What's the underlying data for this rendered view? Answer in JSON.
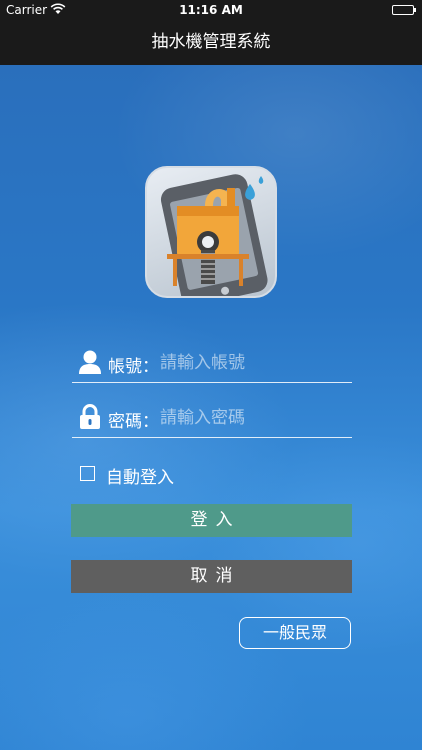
{
  "status_bar": {
    "carrier": "Carrier",
    "time": "11:16 AM"
  },
  "nav": {
    "title": "抽水機管理系統"
  },
  "login": {
    "account_label": "帳號：",
    "account_placeholder": "請輸入帳號",
    "password_label": "密碼：",
    "password_placeholder": "請輸入密碼",
    "auto_login_label": "自動登入",
    "auto_login_checked": false,
    "login_button": "登入",
    "cancel_button": "取消",
    "public_button": "一般民眾"
  },
  "icons": {
    "wifi": "wifi-icon",
    "battery": "battery-icon",
    "user": "user-icon",
    "lock": "lock-icon",
    "app_logo": "pump-phone-logo"
  },
  "colors": {
    "nav_bg": "#1a1a1a",
    "login_button": "#4f9a8a",
    "cancel_button": "#5f5f5f",
    "background": "#2a77c6"
  }
}
